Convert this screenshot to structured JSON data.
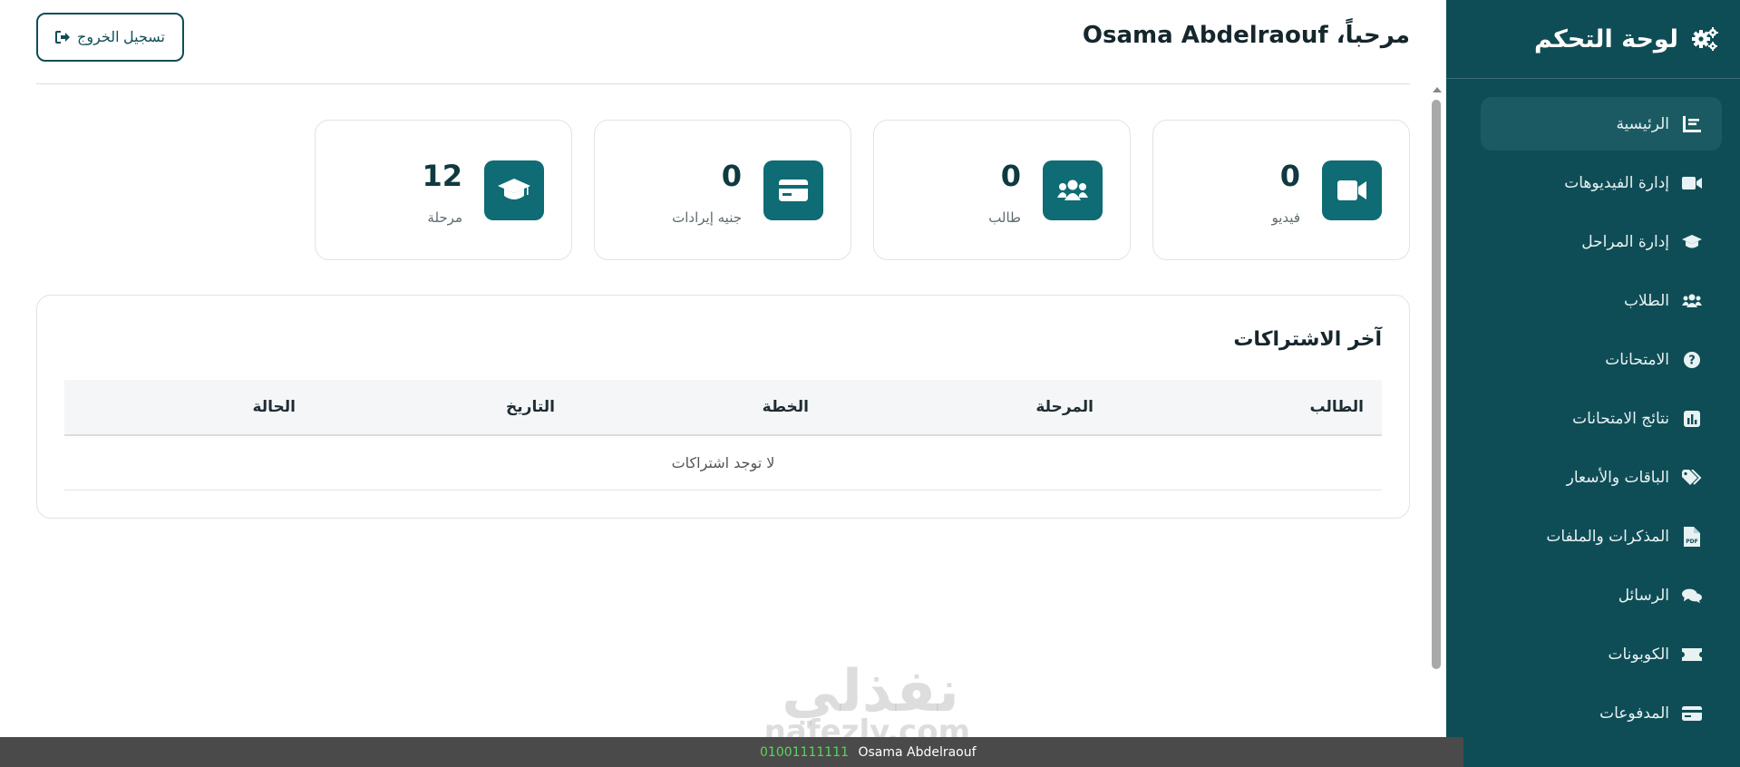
{
  "sidebar": {
    "title": "لوحة التحكم",
    "items": [
      {
        "label": "الرئيسية",
        "icon": "dashboard-icon",
        "active": true
      },
      {
        "label": "إدارة الفيديوهات",
        "icon": "video-icon"
      },
      {
        "label": "إدارة المراحل",
        "icon": "graduation-cap-icon"
      },
      {
        "label": "الطلاب",
        "icon": "users-icon"
      },
      {
        "label": "الامتحانات",
        "icon": "question-circle-icon"
      },
      {
        "label": "نتائج الامتحانات",
        "icon": "chart-bar-icon"
      },
      {
        "label": "الباقات والأسعار",
        "icon": "tags-icon"
      },
      {
        "label": "المذكرات والملفات",
        "icon": "pdf-file-icon"
      },
      {
        "label": "الرسائل",
        "icon": "comments-icon"
      },
      {
        "label": "الكوبونات",
        "icon": "ticket-icon"
      },
      {
        "label": "المدفوعات",
        "icon": "credit-card-icon"
      }
    ]
  },
  "header": {
    "greeting": "مرحباً، Osama Abdelraouf",
    "logout_label": "تسجيل الخروج"
  },
  "stats": [
    {
      "value": "0",
      "label": "فيديو",
      "icon": "video-icon"
    },
    {
      "value": "0",
      "label": "طالب",
      "icon": "users-icon"
    },
    {
      "value": "0",
      "label": "جنيه إيرادات",
      "icon": "credit-card-icon"
    },
    {
      "value": "12",
      "label": "مرحلة",
      "icon": "graduation-cap-icon"
    }
  ],
  "subscriptions": {
    "title": "آخر الاشتراكات",
    "columns": [
      "الطالب",
      "المرحلة",
      "الخطة",
      "التاريخ",
      "الحالة"
    ],
    "empty_text": "لا توجد اشتراكات"
  },
  "watermark": {
    "arabic": "نفذلي",
    "latin": "nafezly.com"
  },
  "bottom_bar": {
    "phone": "01001111111",
    "name": "Osama Abdelraouf"
  },
  "colors": {
    "sidebar": "#0f4d56",
    "accent": "#0f6b74",
    "active_item": "#1c5a63"
  }
}
